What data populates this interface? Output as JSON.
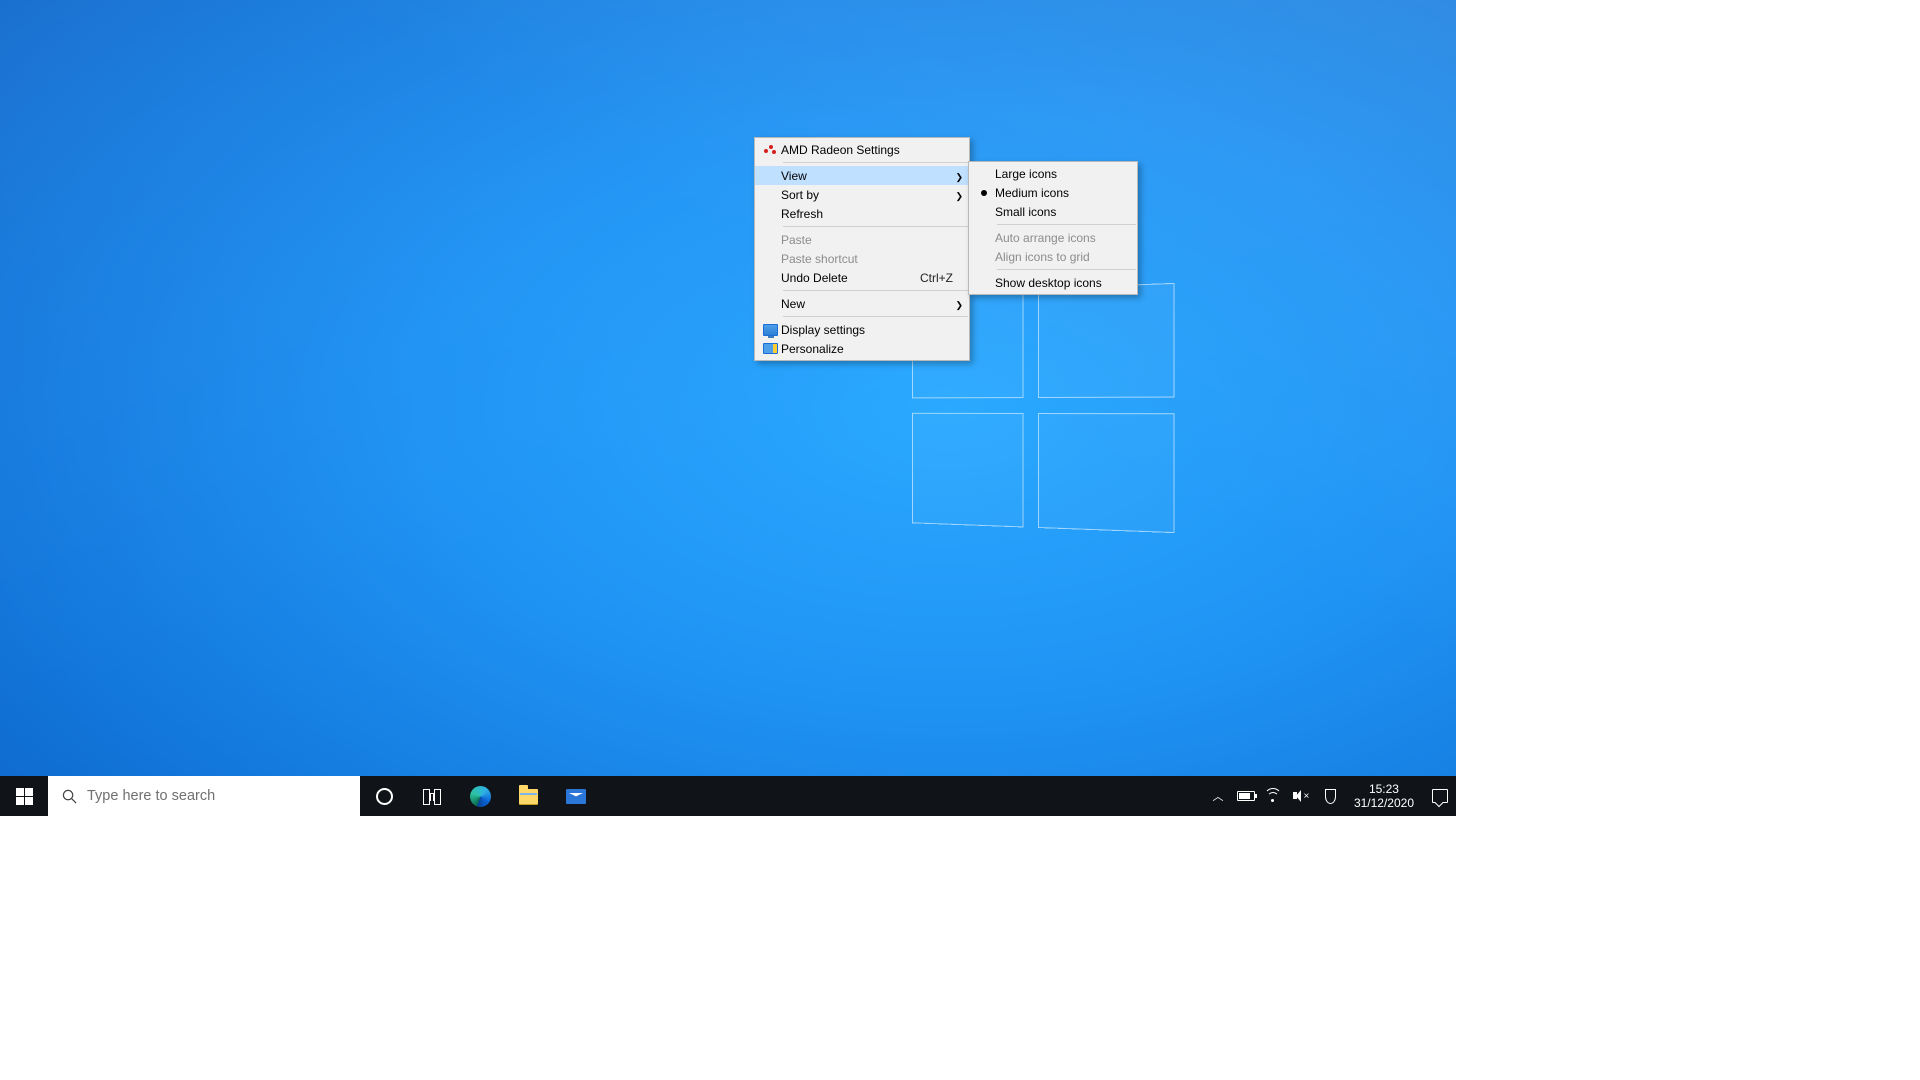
{
  "context_menu": {
    "amd": "AMD Radeon Settings",
    "view": "View",
    "sort_by": "Sort by",
    "refresh": "Refresh",
    "paste": "Paste",
    "paste_shortcut": "Paste shortcut",
    "undo_delete": "Undo Delete",
    "undo_delete_shortcut": "Ctrl+Z",
    "new": "New",
    "display_settings": "Display settings",
    "personalize": "Personalize"
  },
  "view_submenu": {
    "large_icons": "Large icons",
    "medium_icons": "Medium icons",
    "small_icons": "Small icons",
    "auto_arrange": "Auto arrange icons",
    "align_grid": "Align icons to grid",
    "show_desktop_icons": "Show desktop icons"
  },
  "taskbar": {
    "search_placeholder": "Type here to search"
  },
  "tray": {
    "time": "15:23",
    "date": "31/12/2020"
  }
}
